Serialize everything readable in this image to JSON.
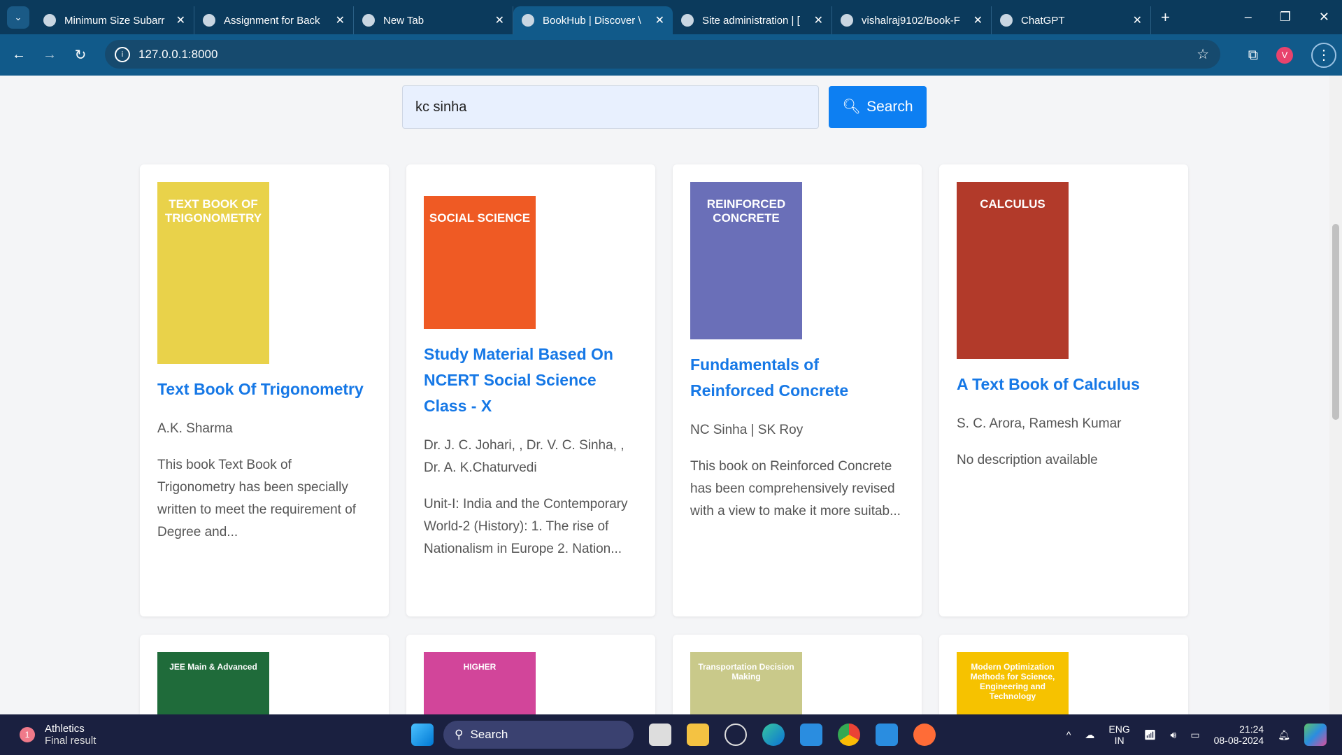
{
  "browser": {
    "tabs": [
      {
        "title": "Minimum Size Subarr",
        "icon": "leetcode-icon"
      },
      {
        "title": "Assignment for Back",
        "icon": "gmail-icon"
      },
      {
        "title": "New Tab",
        "icon": "chrome-icon"
      },
      {
        "title": "BookHub | Discover \\",
        "icon": "globe-icon",
        "active": true
      },
      {
        "title": "Site administration | [",
        "icon": "globe-icon"
      },
      {
        "title": "vishalraj9102/Book-F",
        "icon": "github-icon"
      },
      {
        "title": "ChatGPT",
        "icon": "chatgpt-icon"
      }
    ],
    "url": "127.0.0.1:8000",
    "profile_initial": "V"
  },
  "search": {
    "value": "kc sinha",
    "button": "Search"
  },
  "books": [
    {
      "title": "Text Book Of Trigonometry",
      "author": "A.K. Sharma",
      "description": "This book Text Book of Trigonometry has been specially written to meet the requirement of Degree and...",
      "cover_text": "TEXT BOOK OF TRIGONOMETRY",
      "cover_color": "#e9d24a"
    },
    {
      "title": "Study Material Based On NCERT Social Science Class - X",
      "author": "Dr. J. C. Johari, , Dr. V. C. Sinha, , Dr. A. K.Chaturvedi",
      "description": "Unit-I: India and the Contemporary World-2 (History): 1. The rise of Nationalism in Europe 2. Nation...",
      "cover_text": "SOCIAL SCIENCE",
      "cover_color": "#ef5a24"
    },
    {
      "title": "Fundamentals of Reinforced Concrete",
      "author": "NC Sinha | SK Roy",
      "description": "This book on Reinforced Concrete has been comprehensively revised with a view to make it more suitab...",
      "cover_text": "REINFORCED CONCRETE",
      "cover_color": "#6a6fb8"
    },
    {
      "title": "A Text Book of Calculus",
      "author": "S. C. Arora, Ramesh Kumar",
      "description": "No description available",
      "cover_text": "CALCULUS",
      "cover_color": "#b23a2a"
    }
  ],
  "books_row2": [
    {
      "cover_text": "JEE Main & Advanced",
      "cover_color": "#1f6b3a"
    },
    {
      "cover_text": "HIGHER",
      "cover_color": "#d2459a"
    },
    {
      "cover_text": "Transportation Decision Making",
      "cover_color": "#c9c98a"
    },
    {
      "cover_text": "Modern Optimization Methods for Science, Engineering and Technology",
      "cover_color": "#f6c200"
    }
  ],
  "taskbar": {
    "news_title": "Athletics",
    "news_sub": "Final result",
    "news_badge": "1",
    "search": "Search",
    "lang": "ENG",
    "region": "IN",
    "time": "21:24",
    "date": "08-08-2024"
  }
}
